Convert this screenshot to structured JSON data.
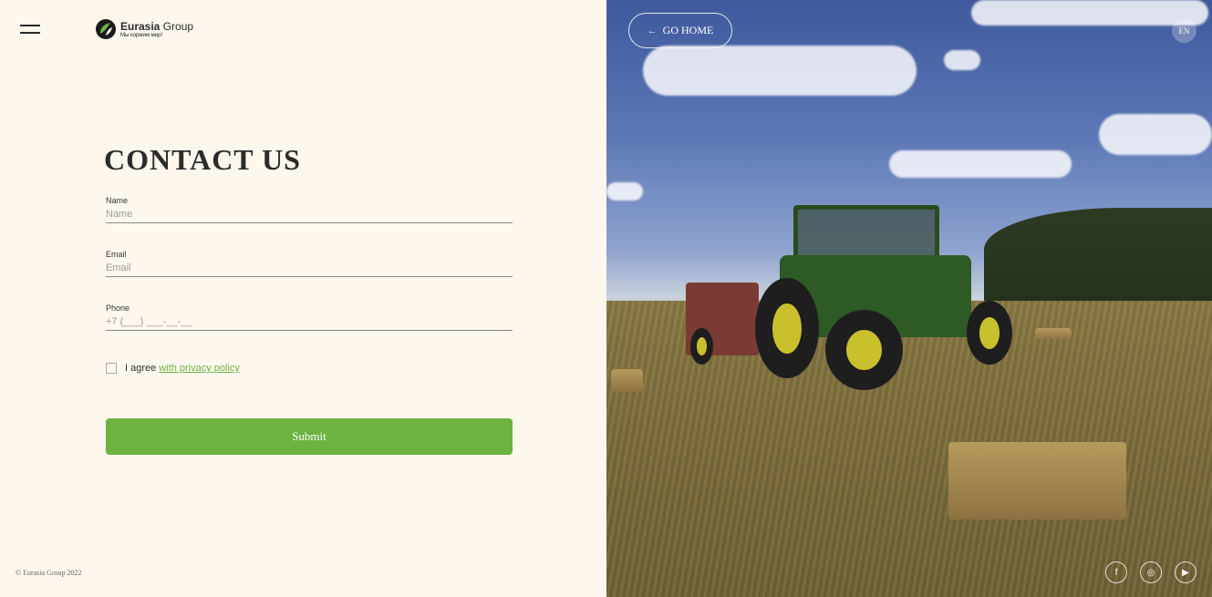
{
  "header": {
    "logo": {
      "name": "Eurasia",
      "suffix": "Group",
      "tagline": "Мы кормим мир!"
    }
  },
  "form": {
    "title": "CONTACT US",
    "fields": [
      {
        "label": "Name",
        "placeholder": "Name"
      },
      {
        "label": "Email",
        "placeholder": "Email"
      },
      {
        "label": "Phone",
        "placeholder": "+7 (___) ___-__-__"
      }
    ],
    "agree": {
      "text": "I agree",
      "link": "with privacy policy",
      "checked": false
    },
    "submit_label": "Submit"
  },
  "footer": {
    "copyright": "© Eurasia Group 2022"
  },
  "hero": {
    "go_home_label": "GO HOME",
    "language": "EN",
    "social": [
      {
        "icon": "facebook-icon",
        "glyph": "f"
      },
      {
        "icon": "instagram-icon",
        "glyph": "◎"
      },
      {
        "icon": "youtube-icon",
        "glyph": "▶"
      }
    ]
  },
  "colors": {
    "accent": "#6cb33f",
    "background": "#fdf7ee",
    "text": "#2b2b2b"
  }
}
